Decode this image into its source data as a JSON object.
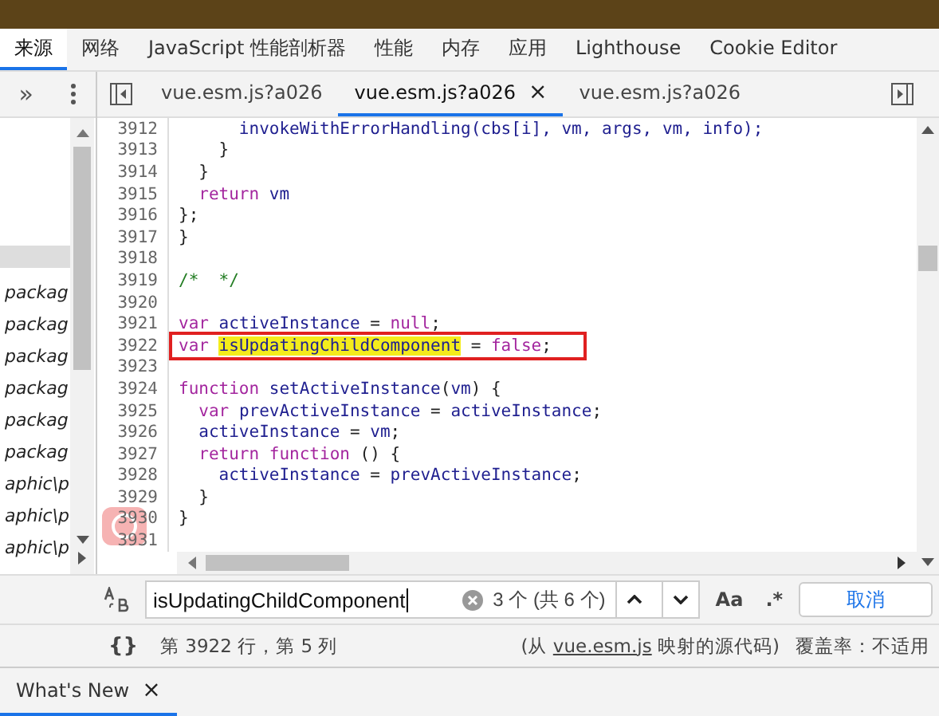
{
  "panel_tabs": [
    {
      "label": "来源",
      "selected": true
    },
    {
      "label": "网络",
      "selected": false
    },
    {
      "label": "JavaScript 性能剖析器",
      "selected": false
    },
    {
      "label": "性能",
      "selected": false
    },
    {
      "label": "内存",
      "selected": false
    },
    {
      "label": "应用",
      "selected": false
    },
    {
      "label": "Lighthouse",
      "selected": false
    },
    {
      "label": "Cookie Editor",
      "selected": false
    }
  ],
  "sidebar": {
    "more": "»",
    "items": [
      {
        "selected": true
      },
      {
        "label": "packag",
        "selected": false
      },
      {
        "label": "packag",
        "selected": false
      },
      {
        "label": "packag",
        "selected": false
      },
      {
        "label": "packag",
        "selected": false
      },
      {
        "label": "packag",
        "selected": false
      },
      {
        "label": "packag",
        "selected": false
      },
      {
        "label": "aphic\\p",
        "selected": false
      },
      {
        "label": "aphic\\p",
        "selected": false
      },
      {
        "label": "aphic\\p",
        "selected": false
      }
    ]
  },
  "editor_tabs": [
    {
      "label": "vue.esm.js?a026",
      "selected": false,
      "closable": false
    },
    {
      "label": "vue.esm.js?a026",
      "selected": true,
      "closable": true
    },
    {
      "label": "vue.esm.js?a026",
      "selected": false,
      "closable": false
    }
  ],
  "close_glyph": "×",
  "code": [
    {
      "number": "3912",
      "marked": false,
      "tokens": [
        {
          "text": "      invokeWithErrorHandling(",
          "kind": "name"
        },
        {
          "text": "cbs",
          "kind": "name"
        },
        {
          "text": "[i], vm, args, vm, info);",
          "kind": "name"
        }
      ]
    },
    {
      "number": "3913",
      "marked": false,
      "tokens": [
        {
          "text": "    }",
          "kind": "punct"
        }
      ]
    },
    {
      "number": "3914",
      "marked": false,
      "tokens": [
        {
          "text": "  }",
          "kind": "punct"
        }
      ]
    },
    {
      "number": "3915",
      "marked": false,
      "tokens": [
        {
          "text": "  return ",
          "kind": "keyword"
        },
        {
          "text": "vm",
          "kind": "name"
        }
      ]
    },
    {
      "number": "3916",
      "marked": false,
      "tokens": [
        {
          "text": "};",
          "kind": "punct"
        }
      ]
    },
    {
      "number": "3917",
      "marked": false,
      "tokens": [
        {
          "text": "}",
          "kind": "punct"
        }
      ]
    },
    {
      "number": "3918",
      "marked": false
    },
    {
      "number": "3919",
      "marked": false,
      "tokens": [
        {
          "text": "/*  */",
          "kind": "comment"
        }
      ]
    },
    {
      "number": "3920",
      "marked": false
    },
    {
      "number": "3921",
      "marked": false,
      "tokens": [
        {
          "text": "var ",
          "kind": "keyword"
        },
        {
          "text": "activeInstance",
          "kind": "name"
        },
        {
          "text": " = ",
          "kind": "punct"
        },
        {
          "text": "null",
          "kind": "keyword"
        },
        {
          "text": ";",
          "kind": "punct"
        }
      ]
    },
    {
      "number": "3922",
      "marked": true,
      "tokens": [
        {
          "text": "var ",
          "kind": "keyword"
        },
        {
          "text": "isUpdatingChildComponent",
          "kind": "match"
        },
        {
          "text": " = ",
          "kind": "punct"
        },
        {
          "text": "false",
          "kind": "keyword"
        },
        {
          "text": ";",
          "kind": "punct"
        }
      ]
    },
    {
      "number": "3923",
      "marked": false
    },
    {
      "number": "3924",
      "marked": false,
      "tokens": [
        {
          "text": "function ",
          "kind": "keyword"
        },
        {
          "text": "setActiveInstance",
          "kind": "name"
        },
        {
          "text": "(",
          "kind": "punct"
        },
        {
          "text": "vm",
          "kind": "name"
        },
        {
          "text": ") {",
          "kind": "punct"
        }
      ]
    },
    {
      "number": "3925",
      "marked": false,
      "tokens": [
        {
          "text": "  var ",
          "kind": "keyword"
        },
        {
          "text": "prevActiveInstance",
          "kind": "name"
        },
        {
          "text": " = ",
          "kind": "punct"
        },
        {
          "text": "activeInstance",
          "kind": "name"
        },
        {
          "text": ";",
          "kind": "punct"
        }
      ]
    },
    {
      "number": "3926",
      "marked": false,
      "tokens": [
        {
          "text": "  activeInstance",
          "kind": "name"
        },
        {
          "text": " = ",
          "kind": "punct"
        },
        {
          "text": "vm",
          "kind": "name"
        },
        {
          "text": ";",
          "kind": "punct"
        }
      ]
    },
    {
      "number": "3927",
      "marked": false,
      "tokens": [
        {
          "text": "  return function ",
          "kind": "keyword"
        },
        {
          "text": "() {",
          "kind": "punct"
        }
      ]
    },
    {
      "number": "3928",
      "marked": false,
      "tokens": [
        {
          "text": "    activeInstance",
          "kind": "name"
        },
        {
          "text": " = ",
          "kind": "punct"
        },
        {
          "text": "prevActiveInstance",
          "kind": "name"
        },
        {
          "text": ";",
          "kind": "punct"
        }
      ]
    },
    {
      "number": "3929",
      "marked": false,
      "tokens": [
        {
          "text": "  }",
          "kind": "punct"
        }
      ]
    },
    {
      "number": "3930",
      "marked": false,
      "tokens": [
        {
          "text": "}",
          "kind": "punct"
        }
      ]
    },
    {
      "number": "3931",
      "marked": false
    }
  ],
  "search": {
    "value": "isUpdatingChildComponent",
    "count": "3 个 (共 6 个)",
    "case_label": "Aa",
    "regex_label": ".*",
    "cancel": "取消"
  },
  "status": {
    "format_label": "{}",
    "position": "第 3922 行，第 5 列",
    "source_prefix": "(从 ",
    "source_link": "vue.esm.js",
    "source_suffix": " 映射的源代码)",
    "coverage": "覆盖率：不适用"
  },
  "drawer_tabs": [
    {
      "label": "What's New",
      "selected": true
    }
  ]
}
